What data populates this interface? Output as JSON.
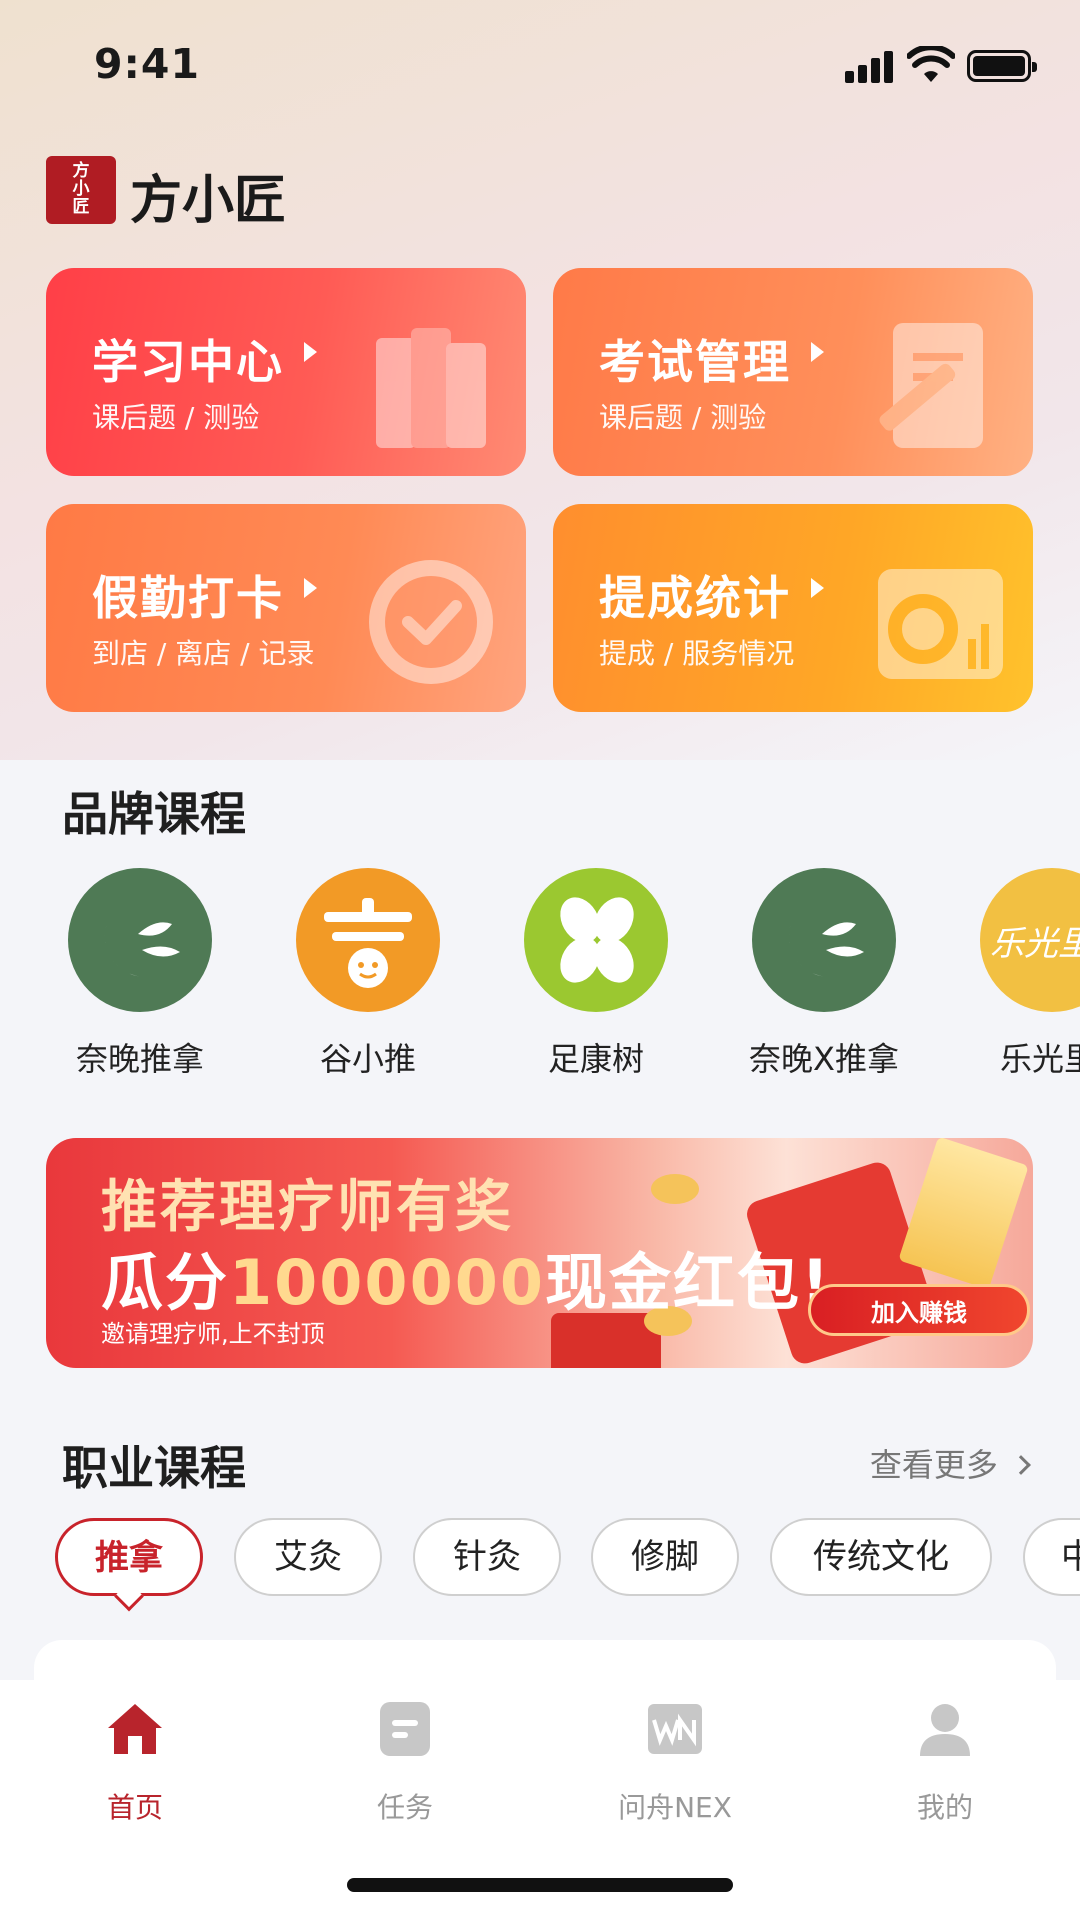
{
  "status_bar": {
    "time": "9:41"
  },
  "header": {
    "logo_text": "方小匠",
    "app_name": "方小匠"
  },
  "feature_cards": [
    {
      "title": "学习中心",
      "subtitle": "课后题 / 测验",
      "icon": "folders-icon"
    },
    {
      "title": "考试管理",
      "subtitle": "课后题 / 测验",
      "icon": "pencil-paper-icon"
    },
    {
      "title": "假勤打卡",
      "subtitle": "到店 / 离店 / 记录",
      "icon": "check-badge-icon"
    },
    {
      "title": "提成统计",
      "subtitle": "提成 / 服务情况",
      "icon": "chart-card-icon"
    }
  ],
  "brand_section": {
    "title": "品牌课程",
    "brands": [
      {
        "label": "奈晚推拿",
        "color": "#4f7a55",
        "icon": "moon-leaf-logo"
      },
      {
        "label": "谷小推",
        "color": "#f29a26",
        "icon": "monkey-logo"
      },
      {
        "label": "足康树",
        "color": "#9bc830",
        "icon": "clover-logo"
      },
      {
        "label": "奈晚X推拿",
        "color": "#4f7a55",
        "icon": "moon-leaf-logo"
      },
      {
        "label": "乐光里",
        "color": "#f2c042",
        "icon": "text-logo",
        "logo_text": "乐光里"
      }
    ]
  },
  "banner": {
    "line1": "推荐理疗师有奖",
    "line2_prefix": "瓜分",
    "line2_amount": "1000000",
    "line2_suffix": "现金红包!",
    "line3": "邀请理疗师,上不封顶",
    "cta": "加入赚钱"
  },
  "career_section": {
    "title": "职业课程",
    "more_label": "查看更多",
    "chips": [
      "推拿",
      "艾灸",
      "针灸",
      "修脚",
      "传统文化",
      "中"
    ],
    "active_chip": "推拿"
  },
  "tabbar": {
    "tabs": [
      {
        "label": "首页",
        "icon": "home-icon",
        "active": true
      },
      {
        "label": "任务",
        "icon": "task-icon",
        "active": false
      },
      {
        "label": "问舟NEX",
        "icon": "wn-icon",
        "active": false
      },
      {
        "label": "我的",
        "icon": "profile-icon",
        "active": false
      }
    ]
  },
  "colors": {
    "primary": "#b8242c",
    "inactive": "#999999"
  }
}
